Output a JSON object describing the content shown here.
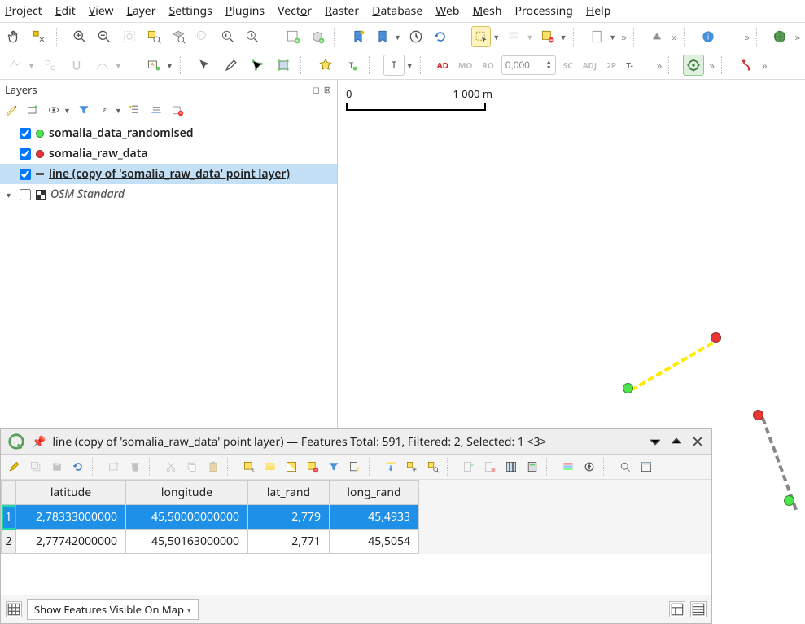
{
  "menu": [
    "Project",
    "Edit",
    "View",
    "Layer",
    "Settings",
    "Plugins",
    "Vector",
    "Raster",
    "Database",
    "Web",
    "Mesh",
    "Processing",
    "Help"
  ],
  "menu_accel": [
    0,
    0,
    0,
    0,
    0,
    0,
    0,
    0,
    0,
    0,
    0,
    -1,
    0
  ],
  "toolbar2": {
    "badges": [
      "AD",
      "MO",
      "RO"
    ],
    "spin_value": "0,000",
    "badges2": [
      "SC",
      "ADJ",
      "2P",
      "T-"
    ]
  },
  "layers_panel": {
    "title": "Layers",
    "items": [
      {
        "checked": true,
        "color": "green",
        "name": "somalia_data_randomised",
        "bold": true
      },
      {
        "checked": true,
        "color": "red",
        "name": "somalia_raw_data",
        "bold": true
      },
      {
        "checked": true,
        "color": "line",
        "name": "line (copy of 'somalia_raw_data' point layer)",
        "bold": true,
        "selected": true,
        "underline": true
      },
      {
        "checked": false,
        "color": "osm",
        "name": "OSM Standard",
        "italic": true,
        "tri": true
      }
    ]
  },
  "scalebar": {
    "left": "0",
    "right": "1 000 m"
  },
  "attr": {
    "title": "line (copy of 'somalia_raw_data' point layer) — Features Total: 591, Filtered: 2, Selected: 1 <3>",
    "columns": [
      "latitude",
      "longitude",
      "lat_rand",
      "long_rand"
    ],
    "rows": [
      {
        "n": "1",
        "sel": true,
        "cells": [
          "2,78333000000",
          "45,50000000000",
          "2,779",
          "45,4933"
        ]
      },
      {
        "n": "2",
        "sel": false,
        "cells": [
          "2,77742000000",
          "45,50163000000",
          "2,771",
          "45,5054"
        ]
      }
    ],
    "footer_combo": "Show Features Visible On Map"
  }
}
